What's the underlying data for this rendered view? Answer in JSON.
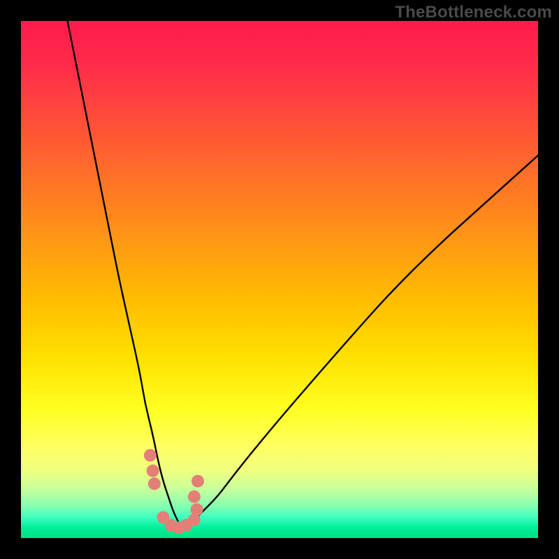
{
  "attribution": "TheBottleneck.com",
  "chart_data": {
    "type": "line",
    "title": "",
    "xlabel": "",
    "ylabel": "",
    "xlim": [
      0,
      100
    ],
    "ylim": [
      0,
      100
    ],
    "series": [
      {
        "name": "left-branch",
        "x": [
          9,
          11,
          13,
          15,
          17,
          19,
          21,
          23,
          24,
          25.5,
          26.5,
          27.5,
          28.5,
          29.5,
          30.5,
          31
        ],
        "values": [
          100,
          90,
          80,
          70,
          60,
          50,
          41,
          32,
          26,
          20,
          15,
          11,
          8,
          5,
          3,
          2
        ]
      },
      {
        "name": "right-branch",
        "x": [
          31,
          33,
          35,
          38,
          41,
          45,
          50,
          56,
          63,
          71,
          80,
          90,
          100
        ],
        "values": [
          2,
          3,
          5,
          8,
          12,
          17,
          23,
          30,
          38,
          47,
          56,
          65,
          74
        ]
      },
      {
        "name": "dot-cluster",
        "type": "scatter",
        "x": [
          25.0,
          25.5,
          25.8,
          27.5,
          29.0,
          30.5,
          32.0,
          33.5,
          34.0,
          33.5,
          34.2
        ],
        "values": [
          16.0,
          13.0,
          10.5,
          4.0,
          2.5,
          2.0,
          2.5,
          3.5,
          5.5,
          8.0,
          11.0
        ]
      }
    ]
  },
  "palette": {
    "curve": "#000000",
    "dots": "#e28078"
  }
}
